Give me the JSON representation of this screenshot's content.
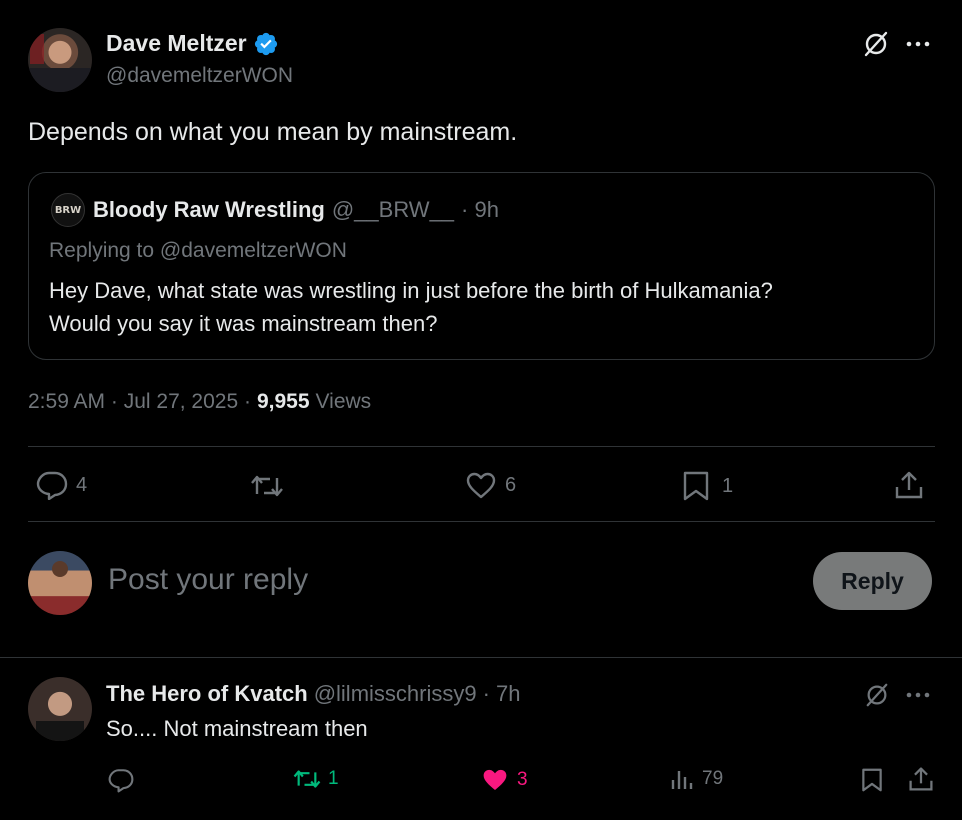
{
  "main_tweet": {
    "author_name": "Dave Meltzer",
    "author_handle": "@davemeltzerWON",
    "text": "Depends on what you mean by mainstream.",
    "quoted": {
      "logo_text": "BRW",
      "author_name": "Bloody Raw Wrestling",
      "author_handle": "@__BRW__",
      "time": "· 9h",
      "replying_to": "Replying to @davemeltzerWON",
      "text_line1": "Hey Dave, what state was wrestling in just before the birth of Hulkamania?",
      "text_line2": "Would you say it was mainstream then?"
    },
    "timestamp": "2:59 AM · Jul 27, 2025 ·",
    "views_count": "9,955",
    "views_label": "Views",
    "actions": {
      "replies": "4",
      "likes": "6",
      "bookmarks": "1"
    }
  },
  "composer": {
    "placeholder": "Post your reply",
    "reply_button": "Reply"
  },
  "reply": {
    "author_name": "The Hero of Kvatch",
    "author_handle": "@lilmisschrissy9",
    "time": "· 7h",
    "text": "So.... Not mainstream then",
    "actions": {
      "reposts": "1",
      "likes": "3",
      "views": "79"
    }
  },
  "colors": {
    "verified": "#1d9bf0",
    "repost_active": "#00ba7c",
    "like_active": "#f91880",
    "muted": "#71767b"
  }
}
